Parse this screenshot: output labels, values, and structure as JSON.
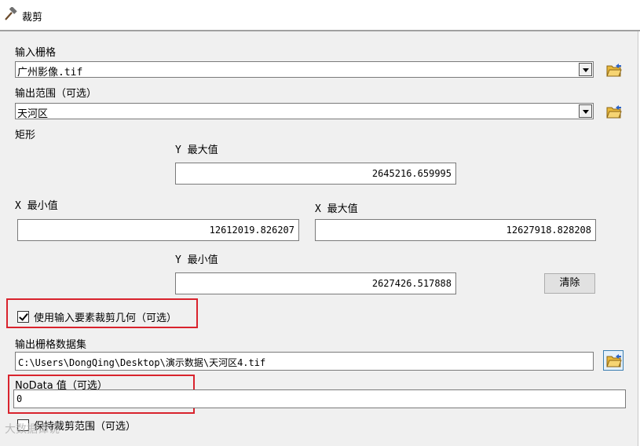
{
  "window": {
    "title": "裁剪",
    "icon": "hammer-icon"
  },
  "input_raster": {
    "label": "输入栅格",
    "value": "广州影像.tif",
    "icon": "folder-open-icon"
  },
  "output_extent": {
    "label": "输出范围（可选）",
    "value": "天河区",
    "icon": "folder-open-icon"
  },
  "rectangle": {
    "label": "矩形",
    "y_max_label": "Y 最大值",
    "y_max_value": "2645216.659995",
    "x_min_label": "X 最小值",
    "x_min_value": "12612019.826207",
    "x_max_label": "X 最大值",
    "x_max_value": "12627918.828208",
    "y_min_label": "Y 最小值",
    "y_min_value": "2627426.517888",
    "clear_label": "清除"
  },
  "use_input_features": {
    "label": "使用输入要素裁剪几何（可选）",
    "checked": true
  },
  "output_raster": {
    "label": "输出栅格数据集",
    "value": "C:\\Users\\DongQing\\Desktop\\演示数据\\天河区4.tif",
    "icon": "folder-open-icon"
  },
  "nodata": {
    "label": "NoData 值（可选）",
    "value": "0"
  },
  "maintain_extent": {
    "label": "保持裁剪范围（可选）",
    "checked": false
  },
  "watermark": "大数据谭说",
  "colors": {
    "highlight": "#d9232d",
    "panel": "#f0f0f0",
    "folder": "#e8b83a"
  }
}
